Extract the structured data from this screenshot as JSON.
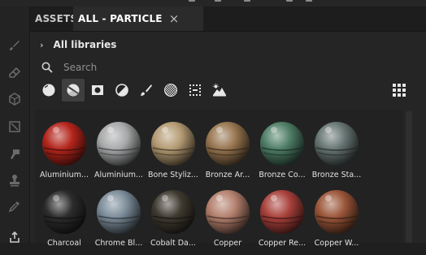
{
  "tabs": {
    "assets_label": "ASSETS",
    "active_label": "ALL - PARTICLE",
    "close_glyph": "×"
  },
  "breadcrumb": {
    "chevron": "›",
    "label": "All libraries"
  },
  "search": {
    "placeholder": "Search",
    "value": ""
  },
  "filters": [
    {
      "name": "smart-materials-filter",
      "icon": "sphere-filled-icon",
      "selected": false
    },
    {
      "name": "materials-filter",
      "icon": "sphere-split-icon",
      "selected": true
    },
    {
      "name": "smart-masks-filter",
      "icon": "square-mask-icon",
      "selected": false
    },
    {
      "name": "filters-filter",
      "icon": "half-circle-icon",
      "selected": false
    },
    {
      "name": "brushes-filter",
      "icon": "brush-icon",
      "selected": false
    },
    {
      "name": "textures-filter",
      "icon": "checker-circle-icon",
      "selected": false
    },
    {
      "name": "particles-filter",
      "icon": "dotted-grid-icon",
      "selected": false
    },
    {
      "name": "environments-filter",
      "icon": "landscape-icon",
      "selected": false
    }
  ],
  "materials": [
    {
      "label": "Aluminium...",
      "color": "#b3251c"
    },
    {
      "label": "Aluminium...",
      "color": "#a8a9aa"
    },
    {
      "label": "Bone Styliz...",
      "color": "#b39a72"
    },
    {
      "label": "Bronze Ar...",
      "color": "#97754f"
    },
    {
      "label": "Bronze Co...",
      "color": "#4e7d66"
    },
    {
      "label": "Bronze Sta...",
      "color": "#667573"
    },
    {
      "label": "Charcoal",
      "color": "#2c2c2c"
    },
    {
      "label": "Chrome Bl...",
      "color": "#7b8c99"
    },
    {
      "label": "Cobalt Da...",
      "color": "#3f3a30"
    },
    {
      "label": "Copper",
      "color": "#b37f6d"
    },
    {
      "label": "Copper Re...",
      "color": "#a8403a"
    },
    {
      "label": "Copper W...",
      "color": "#9a5539"
    }
  ],
  "colors": {
    "panel_bg": "#252525",
    "tab_active_bg": "#2b2b2b",
    "filter_selected_bg": "#3f3f3f"
  }
}
